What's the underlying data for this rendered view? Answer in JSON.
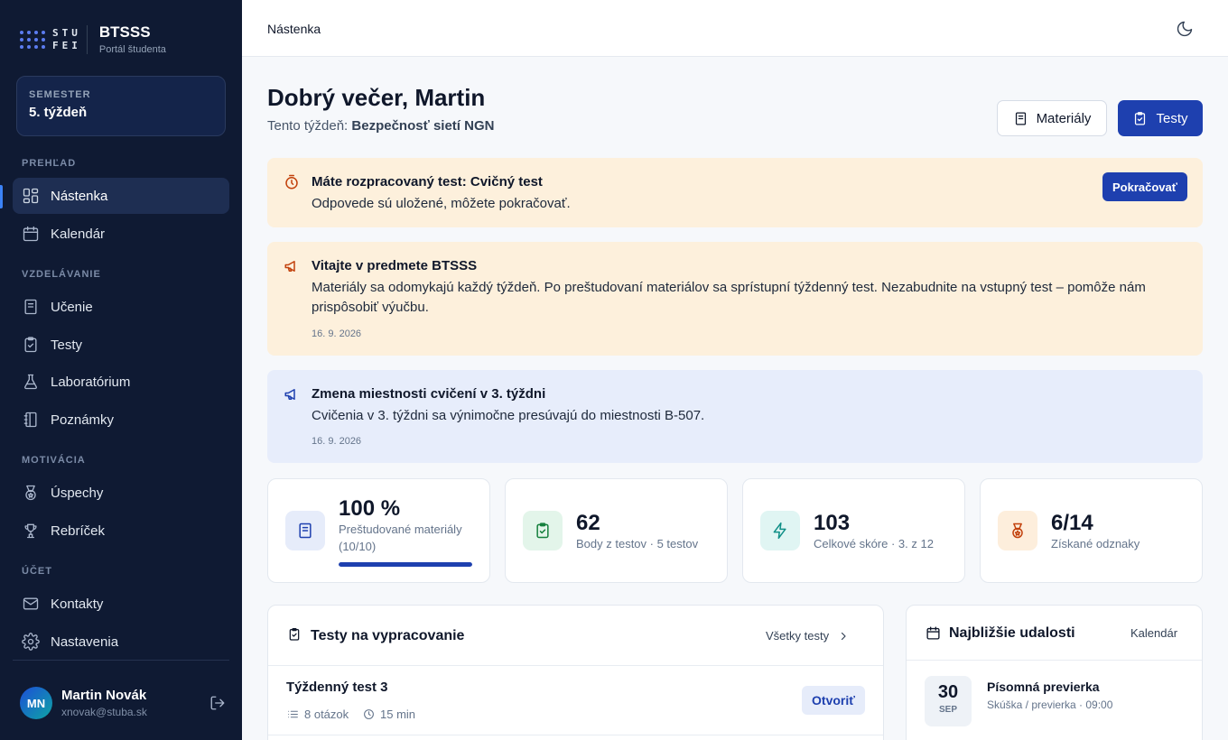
{
  "brand": {
    "logo_text_1": "STU",
    "logo_text_2": "FEI",
    "title": "BTSSS",
    "subtitle": "Portál študenta"
  },
  "semester": {
    "label": "SEMESTER",
    "value": "5. týždeň"
  },
  "sidebar": {
    "sections": [
      "PREHĽAD",
      "VZDELÁVANIE",
      "MOTIVÁCIA",
      "ÚČET"
    ],
    "items": [
      {
        "label": "Nástenka",
        "icon": "dashboard-icon",
        "active": true
      },
      {
        "label": "Kalendár",
        "icon": "calendar-icon"
      },
      {
        "label": "Učenie",
        "icon": "book-icon"
      },
      {
        "label": "Testy",
        "icon": "clipboard-check-icon"
      },
      {
        "label": "Laboratórium",
        "icon": "flask-icon"
      },
      {
        "label": "Poznámky",
        "icon": "notebook-icon"
      },
      {
        "label": "Úspechy",
        "icon": "medal-icon"
      },
      {
        "label": "Rebríček",
        "icon": "trophy-icon"
      },
      {
        "label": "Kontakty",
        "icon": "mail-icon"
      },
      {
        "label": "Nastavenia",
        "icon": "gear-icon"
      }
    ]
  },
  "user": {
    "initials": "MN",
    "name": "Martin Novák",
    "email": "xnovak@stuba.sk"
  },
  "topbar": {
    "breadcrumb": "Nástenka",
    "theme_icon": "moon-icon"
  },
  "header": {
    "greeting": "Dobrý večer, Martin",
    "week_prefix": "Tento týždeň: ",
    "week_topic": "Bezpečnosť sietí NGN",
    "materials_button": "Materiály",
    "tests_button": "Testy"
  },
  "alerts": [
    {
      "title": "Máte rozpracovaný test: Cvičný test",
      "text": "Odpovede sú uložené, môžete pokračovať.",
      "button": "Pokračovať",
      "icon": "timer-icon"
    },
    {
      "title": "Vitajte v predmete BTSSS",
      "text": "Materiály sa odomykajú každý týždeň. Po preštudovaní materiálov sa sprístupní týždenný test. Nezabudnite na vstupný test – pomôže nám prispôsobiť výučbu.",
      "date": "16. 9. 2026",
      "icon": "megaphone-icon"
    },
    {
      "title": "Zmena miestnosti cvičení v 3. týždni",
      "text": "Cvičenia v 3. týždni sa výnimočne presúvajú do miestnosti B-507.",
      "date": "16. 9. 2026",
      "icon": "megaphone-icon"
    }
  ],
  "stats": [
    {
      "value": "100 %",
      "label_1": "Preštudované materiály",
      "label_2": "(10/10)",
      "progress": 1.0,
      "icon": "book-icon"
    },
    {
      "value": "62",
      "label": "Body z testov · 5 testov",
      "icon": "clipboard-check-icon"
    },
    {
      "value": "103",
      "label": "Celkové skóre · 3. z 12",
      "icon": "lightning-icon"
    },
    {
      "value": "6/14",
      "label": "Získané odznaky",
      "icon": "medal-icon"
    }
  ],
  "tests_card": {
    "title": "Testy na vypracovanie",
    "link": "Všetky testy",
    "items": [
      {
        "name": "Týždenný test 3",
        "questions": "8 otázok",
        "duration": "15 min",
        "button": "Otvoriť"
      }
    ]
  },
  "events_card": {
    "title": "Najbližšie udalosti",
    "link": "Kalendár",
    "items": [
      {
        "day": "30",
        "month": "SEP",
        "title": "Písomná previerka",
        "subtitle": "Skúška / previerka · 09:00"
      }
    ]
  },
  "colors": {
    "sidebar_bg": "#0f1a33",
    "primary": "#1e40af",
    "warning_bg": "#fdf0dc",
    "info_bg": "#e7edfb",
    "warning_icon": "#c2410c"
  }
}
